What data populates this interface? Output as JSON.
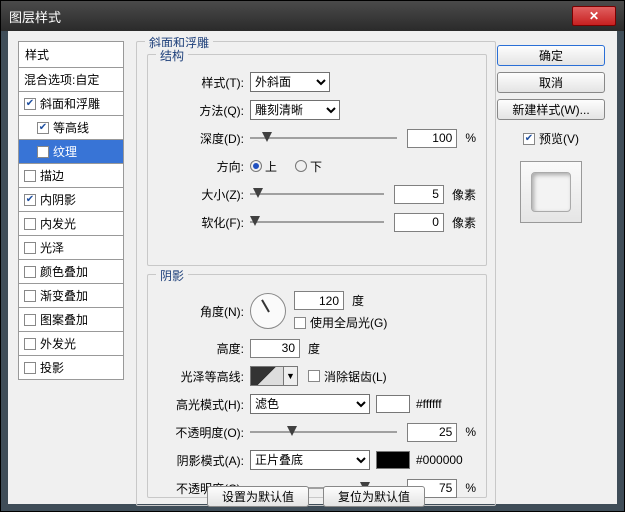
{
  "window": {
    "title": "图层样式"
  },
  "styleList": {
    "header": "样式",
    "blend": "混合选项:自定",
    "items": [
      {
        "label": "斜面和浮雕",
        "checked": true,
        "selected": false,
        "child": false
      },
      {
        "label": "等高线",
        "checked": true,
        "selected": false,
        "child": true
      },
      {
        "label": "纹理",
        "checked": false,
        "selected": true,
        "child": true
      },
      {
        "label": "描边",
        "checked": false,
        "selected": false,
        "child": false
      },
      {
        "label": "内阴影",
        "checked": true,
        "selected": false,
        "child": false
      },
      {
        "label": "内发光",
        "checked": false,
        "selected": false,
        "child": false
      },
      {
        "label": "光泽",
        "checked": false,
        "selected": false,
        "child": false
      },
      {
        "label": "颜色叠加",
        "checked": false,
        "selected": false,
        "child": false
      },
      {
        "label": "渐变叠加",
        "checked": false,
        "selected": false,
        "child": false
      },
      {
        "label": "图案叠加",
        "checked": false,
        "selected": false,
        "child": false
      },
      {
        "label": "外发光",
        "checked": false,
        "selected": false,
        "child": false
      },
      {
        "label": "投影",
        "checked": false,
        "selected": false,
        "child": false
      }
    ]
  },
  "bevel": {
    "group": "斜面和浮雕",
    "structure": {
      "legend": "结构",
      "styleLabel": "样式(T):",
      "styleValue": "外斜面",
      "techLabel": "方法(Q):",
      "techValue": "雕刻清晰",
      "depthLabel": "深度(D):",
      "depthValue": "100",
      "depthUnit": "%",
      "dirLabel": "方向:",
      "up": "上",
      "down": "下",
      "sizeLabel": "大小(Z):",
      "sizeValue": "5",
      "sizeUnit": "像素",
      "softLabel": "软化(F):",
      "softValue": "0",
      "softUnit": "像素"
    },
    "shading": {
      "legend": "阴影",
      "angleLabel": "角度(N):",
      "angleValue": "120",
      "angleUnit": "度",
      "globalLabel": "使用全局光(G)",
      "altitudeLabel": "高度:",
      "altitudeValue": "30",
      "altitudeUnit": "度",
      "glossLabel": "光泽等高线:",
      "antialiasLabel": "消除锯齿(L)",
      "hiModeLabel": "高光模式(H):",
      "hiModeValue": "滤色",
      "hiColor": "#ffffff",
      "hiHex": "#ffffff",
      "hiOpacityLabel": "不透明度(O):",
      "hiOpacityValue": "25",
      "pct": "%",
      "shModeLabel": "阴影模式(A):",
      "shModeValue": "正片叠底",
      "shColor": "#000000",
      "shHex": "#000000",
      "shOpacityLabel": "不透明度(C):",
      "shOpacityValue": "75"
    },
    "makeDefault": "设置为默认值",
    "resetDefault": "复位为默认值"
  },
  "right": {
    "ok": "确定",
    "cancel": "取消",
    "newStyle": "新建样式(W)...",
    "preview": "预览(V)"
  }
}
